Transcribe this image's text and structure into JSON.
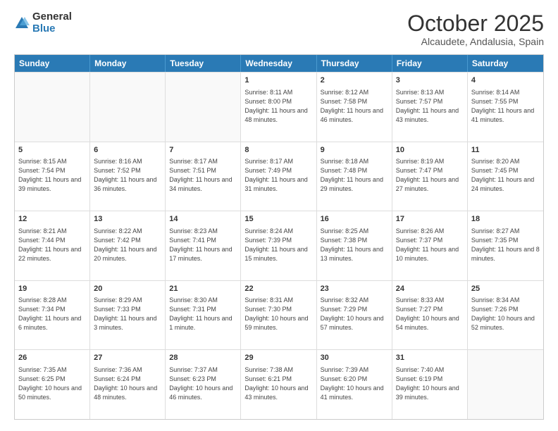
{
  "logo": {
    "general": "General",
    "blue": "Blue"
  },
  "header": {
    "month": "October 2025",
    "location": "Alcaudete, Andalusia, Spain"
  },
  "weekdays": [
    "Sunday",
    "Monday",
    "Tuesday",
    "Wednesday",
    "Thursday",
    "Friday",
    "Saturday"
  ],
  "rows": [
    [
      {
        "day": "",
        "info": ""
      },
      {
        "day": "",
        "info": ""
      },
      {
        "day": "",
        "info": ""
      },
      {
        "day": "1",
        "info": "Sunrise: 8:11 AM\nSunset: 8:00 PM\nDaylight: 11 hours and 48 minutes."
      },
      {
        "day": "2",
        "info": "Sunrise: 8:12 AM\nSunset: 7:58 PM\nDaylight: 11 hours and 46 minutes."
      },
      {
        "day": "3",
        "info": "Sunrise: 8:13 AM\nSunset: 7:57 PM\nDaylight: 11 hours and 43 minutes."
      },
      {
        "day": "4",
        "info": "Sunrise: 8:14 AM\nSunset: 7:55 PM\nDaylight: 11 hours and 41 minutes."
      }
    ],
    [
      {
        "day": "5",
        "info": "Sunrise: 8:15 AM\nSunset: 7:54 PM\nDaylight: 11 hours and 39 minutes."
      },
      {
        "day": "6",
        "info": "Sunrise: 8:16 AM\nSunset: 7:52 PM\nDaylight: 11 hours and 36 minutes."
      },
      {
        "day": "7",
        "info": "Sunrise: 8:17 AM\nSunset: 7:51 PM\nDaylight: 11 hours and 34 minutes."
      },
      {
        "day": "8",
        "info": "Sunrise: 8:17 AM\nSunset: 7:49 PM\nDaylight: 11 hours and 31 minutes."
      },
      {
        "day": "9",
        "info": "Sunrise: 8:18 AM\nSunset: 7:48 PM\nDaylight: 11 hours and 29 minutes."
      },
      {
        "day": "10",
        "info": "Sunrise: 8:19 AM\nSunset: 7:47 PM\nDaylight: 11 hours and 27 minutes."
      },
      {
        "day": "11",
        "info": "Sunrise: 8:20 AM\nSunset: 7:45 PM\nDaylight: 11 hours and 24 minutes."
      }
    ],
    [
      {
        "day": "12",
        "info": "Sunrise: 8:21 AM\nSunset: 7:44 PM\nDaylight: 11 hours and 22 minutes."
      },
      {
        "day": "13",
        "info": "Sunrise: 8:22 AM\nSunset: 7:42 PM\nDaylight: 11 hours and 20 minutes."
      },
      {
        "day": "14",
        "info": "Sunrise: 8:23 AM\nSunset: 7:41 PM\nDaylight: 11 hours and 17 minutes."
      },
      {
        "day": "15",
        "info": "Sunrise: 8:24 AM\nSunset: 7:39 PM\nDaylight: 11 hours and 15 minutes."
      },
      {
        "day": "16",
        "info": "Sunrise: 8:25 AM\nSunset: 7:38 PM\nDaylight: 11 hours and 13 minutes."
      },
      {
        "day": "17",
        "info": "Sunrise: 8:26 AM\nSunset: 7:37 PM\nDaylight: 11 hours and 10 minutes."
      },
      {
        "day": "18",
        "info": "Sunrise: 8:27 AM\nSunset: 7:35 PM\nDaylight: 11 hours and 8 minutes."
      }
    ],
    [
      {
        "day": "19",
        "info": "Sunrise: 8:28 AM\nSunset: 7:34 PM\nDaylight: 11 hours and 6 minutes."
      },
      {
        "day": "20",
        "info": "Sunrise: 8:29 AM\nSunset: 7:33 PM\nDaylight: 11 hours and 3 minutes."
      },
      {
        "day": "21",
        "info": "Sunrise: 8:30 AM\nSunset: 7:31 PM\nDaylight: 11 hours and 1 minute."
      },
      {
        "day": "22",
        "info": "Sunrise: 8:31 AM\nSunset: 7:30 PM\nDaylight: 10 hours and 59 minutes."
      },
      {
        "day": "23",
        "info": "Sunrise: 8:32 AM\nSunset: 7:29 PM\nDaylight: 10 hours and 57 minutes."
      },
      {
        "day": "24",
        "info": "Sunrise: 8:33 AM\nSunset: 7:27 PM\nDaylight: 10 hours and 54 minutes."
      },
      {
        "day": "25",
        "info": "Sunrise: 8:34 AM\nSunset: 7:26 PM\nDaylight: 10 hours and 52 minutes."
      }
    ],
    [
      {
        "day": "26",
        "info": "Sunrise: 7:35 AM\nSunset: 6:25 PM\nDaylight: 10 hours and 50 minutes."
      },
      {
        "day": "27",
        "info": "Sunrise: 7:36 AM\nSunset: 6:24 PM\nDaylight: 10 hours and 48 minutes."
      },
      {
        "day": "28",
        "info": "Sunrise: 7:37 AM\nSunset: 6:23 PM\nDaylight: 10 hours and 46 minutes."
      },
      {
        "day": "29",
        "info": "Sunrise: 7:38 AM\nSunset: 6:21 PM\nDaylight: 10 hours and 43 minutes."
      },
      {
        "day": "30",
        "info": "Sunrise: 7:39 AM\nSunset: 6:20 PM\nDaylight: 10 hours and 41 minutes."
      },
      {
        "day": "31",
        "info": "Sunrise: 7:40 AM\nSunset: 6:19 PM\nDaylight: 10 hours and 39 minutes."
      },
      {
        "day": "",
        "info": ""
      }
    ]
  ]
}
